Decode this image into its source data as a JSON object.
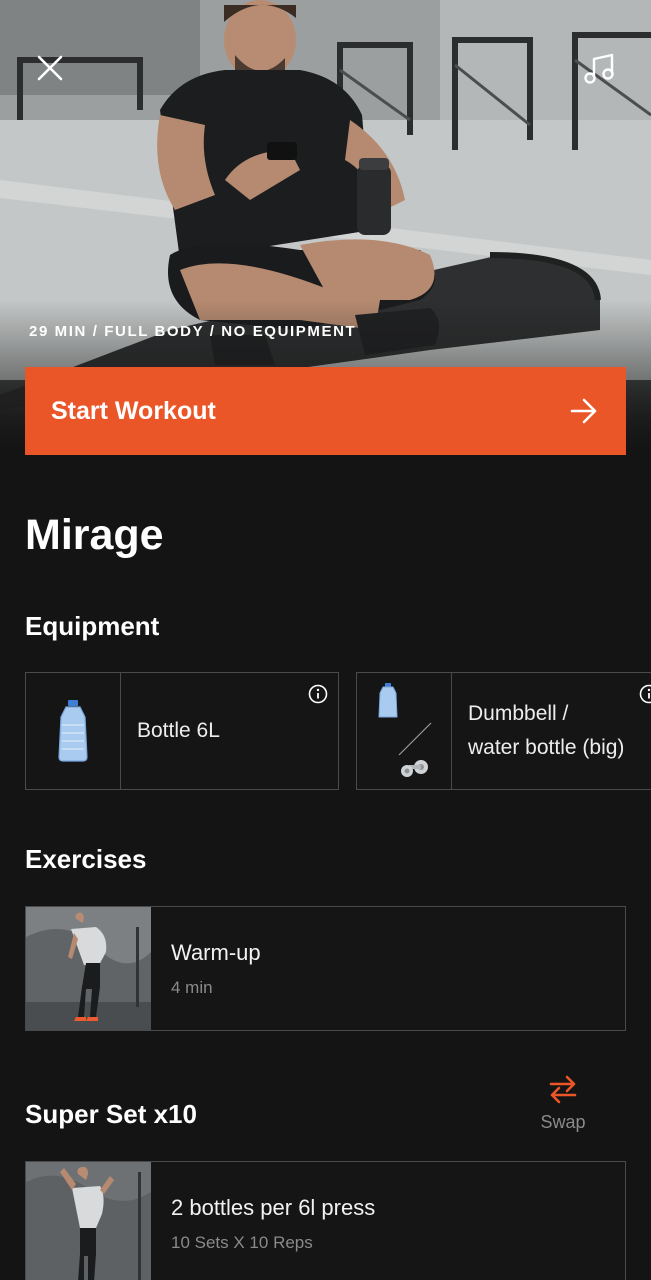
{
  "hero": {
    "meta": "29 MIN / FULL BODY / NO EQUIPMENT",
    "start_label": "Start Workout",
    "close_icon": "close-icon",
    "music_icon": "music-note-icon",
    "start_icon": "arrow-right-icon"
  },
  "workout": {
    "title": "Mirage"
  },
  "equipment": {
    "heading": "Equipment",
    "items": [
      {
        "label": "Bottle 6L",
        "icon": "water-bottle-icon"
      },
      {
        "label_line1": "Dumbbell /",
        "label_line2": "water bottle (big)",
        "icon": "bottle-dumbbell-icon"
      }
    ]
  },
  "exercises": {
    "heading": "Exercises",
    "items": [
      {
        "name": "Warm-up",
        "detail": "4 min"
      }
    ]
  },
  "superset": {
    "heading": "Super Set x10",
    "swap_label": "Swap",
    "swap_icon": "swap-arrows-icon",
    "items": [
      {
        "name": "2 bottles per 6l press",
        "detail": "10 Sets X 10 Reps"
      }
    ]
  },
  "colors": {
    "accent": "#eb5629",
    "background": "#141414",
    "border": "#4a4a4a"
  }
}
